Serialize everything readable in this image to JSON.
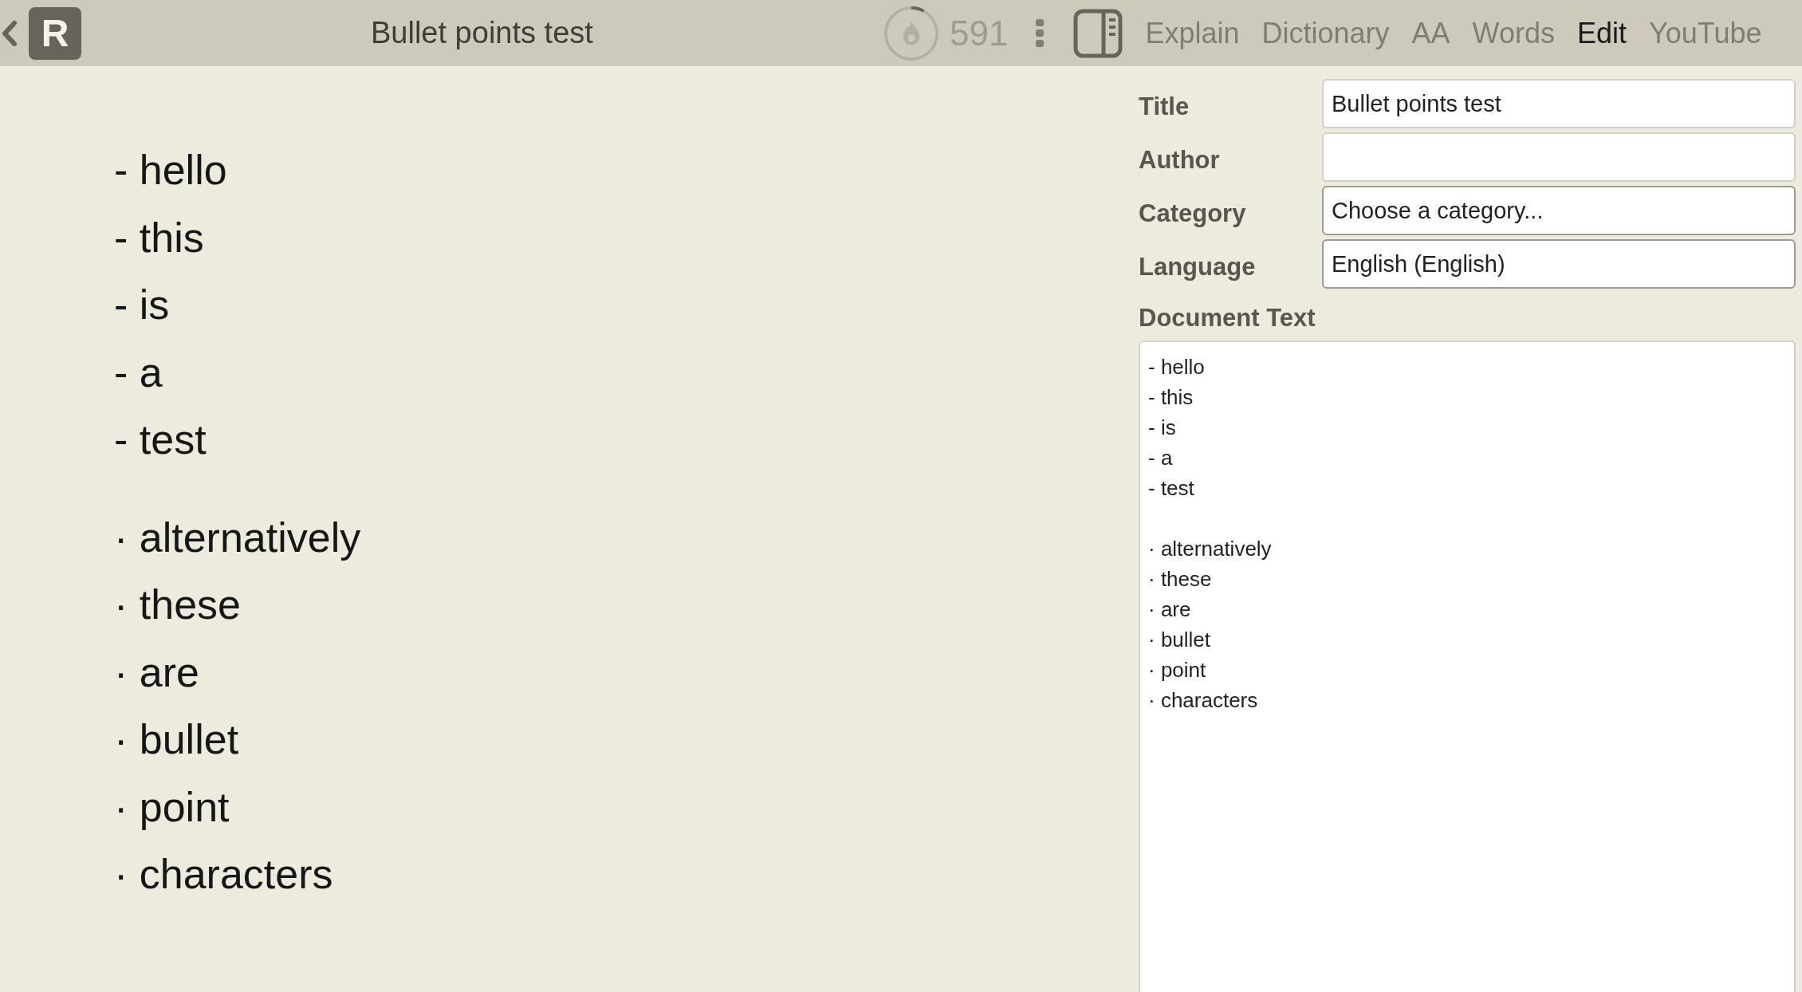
{
  "header": {
    "logo": "R",
    "title": "Bullet points test",
    "streak": {
      "count": "591",
      "level": 0.08
    },
    "tabs": [
      {
        "label": "Explain",
        "selected": false
      },
      {
        "label": "Dictionary",
        "selected": false
      },
      {
        "label": "AA",
        "selected": false
      },
      {
        "label": "Words",
        "selected": false
      },
      {
        "label": "Edit",
        "selected": true
      },
      {
        "label": "YouTube",
        "selected": false
      }
    ]
  },
  "reader": {
    "paragraphs": [
      {
        "lines": [
          "- hello",
          "- this",
          "- is",
          "- a",
          "- test"
        ]
      },
      {
        "lines": [
          "· alternatively",
          "· these",
          "· are",
          "· bullet",
          "· point",
          "· characters"
        ]
      }
    ]
  },
  "editor": {
    "fields": [
      {
        "label": "Title",
        "value": "Bullet points test",
        "kind": "text"
      },
      {
        "label": "Author",
        "kind": "text"
      },
      {
        "label": "Category",
        "value": "Choose a category...",
        "kind": "select"
      },
      {
        "label": "Language",
        "value": "English (English)",
        "kind": "select"
      }
    ],
    "document_text": {
      "label": "Document Text",
      "paragraphs": [
        {
          "lines": [
            "- hello",
            "- this",
            "- is",
            "- a",
            "- test"
          ]
        },
        {
          "lines": [
            "· alternatively",
            "· these",
            "· are",
            "· bullet",
            "· point",
            "· characters"
          ]
        }
      ]
    }
  }
}
